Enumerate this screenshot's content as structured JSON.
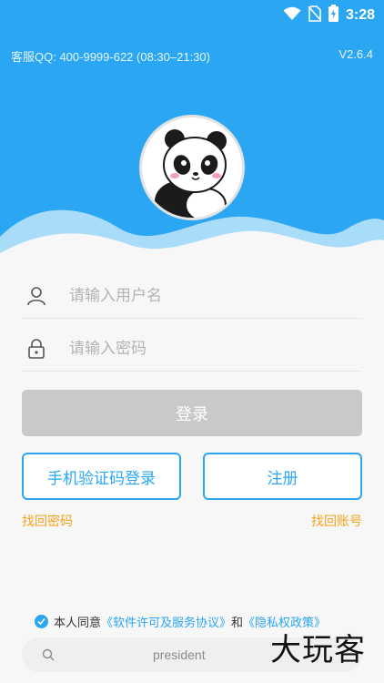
{
  "status_bar": {
    "time": "3:28",
    "icons": [
      "wifi-icon",
      "no-sim-icon",
      "battery-charging-icon"
    ]
  },
  "header": {
    "support": "客服QQ: 400-9999-622 (08:30–21:30)",
    "version": "V2.6.4",
    "background_color": "#2aa6f2"
  },
  "form": {
    "username_placeholder": "请输入用户名",
    "password_placeholder": "请输入密码",
    "login_label": "登录",
    "sms_login_label": "手机验证码登录",
    "register_label": "注册",
    "forgot_password": "找回密码",
    "find_account": "找回账号"
  },
  "agreement": {
    "prefix": "本人同意",
    "license": "《软件许可及服务协议》",
    "and": "和",
    "privacy": "《隐私权政策》"
  },
  "search": {
    "text": "president"
  },
  "watermark": "大玩客"
}
